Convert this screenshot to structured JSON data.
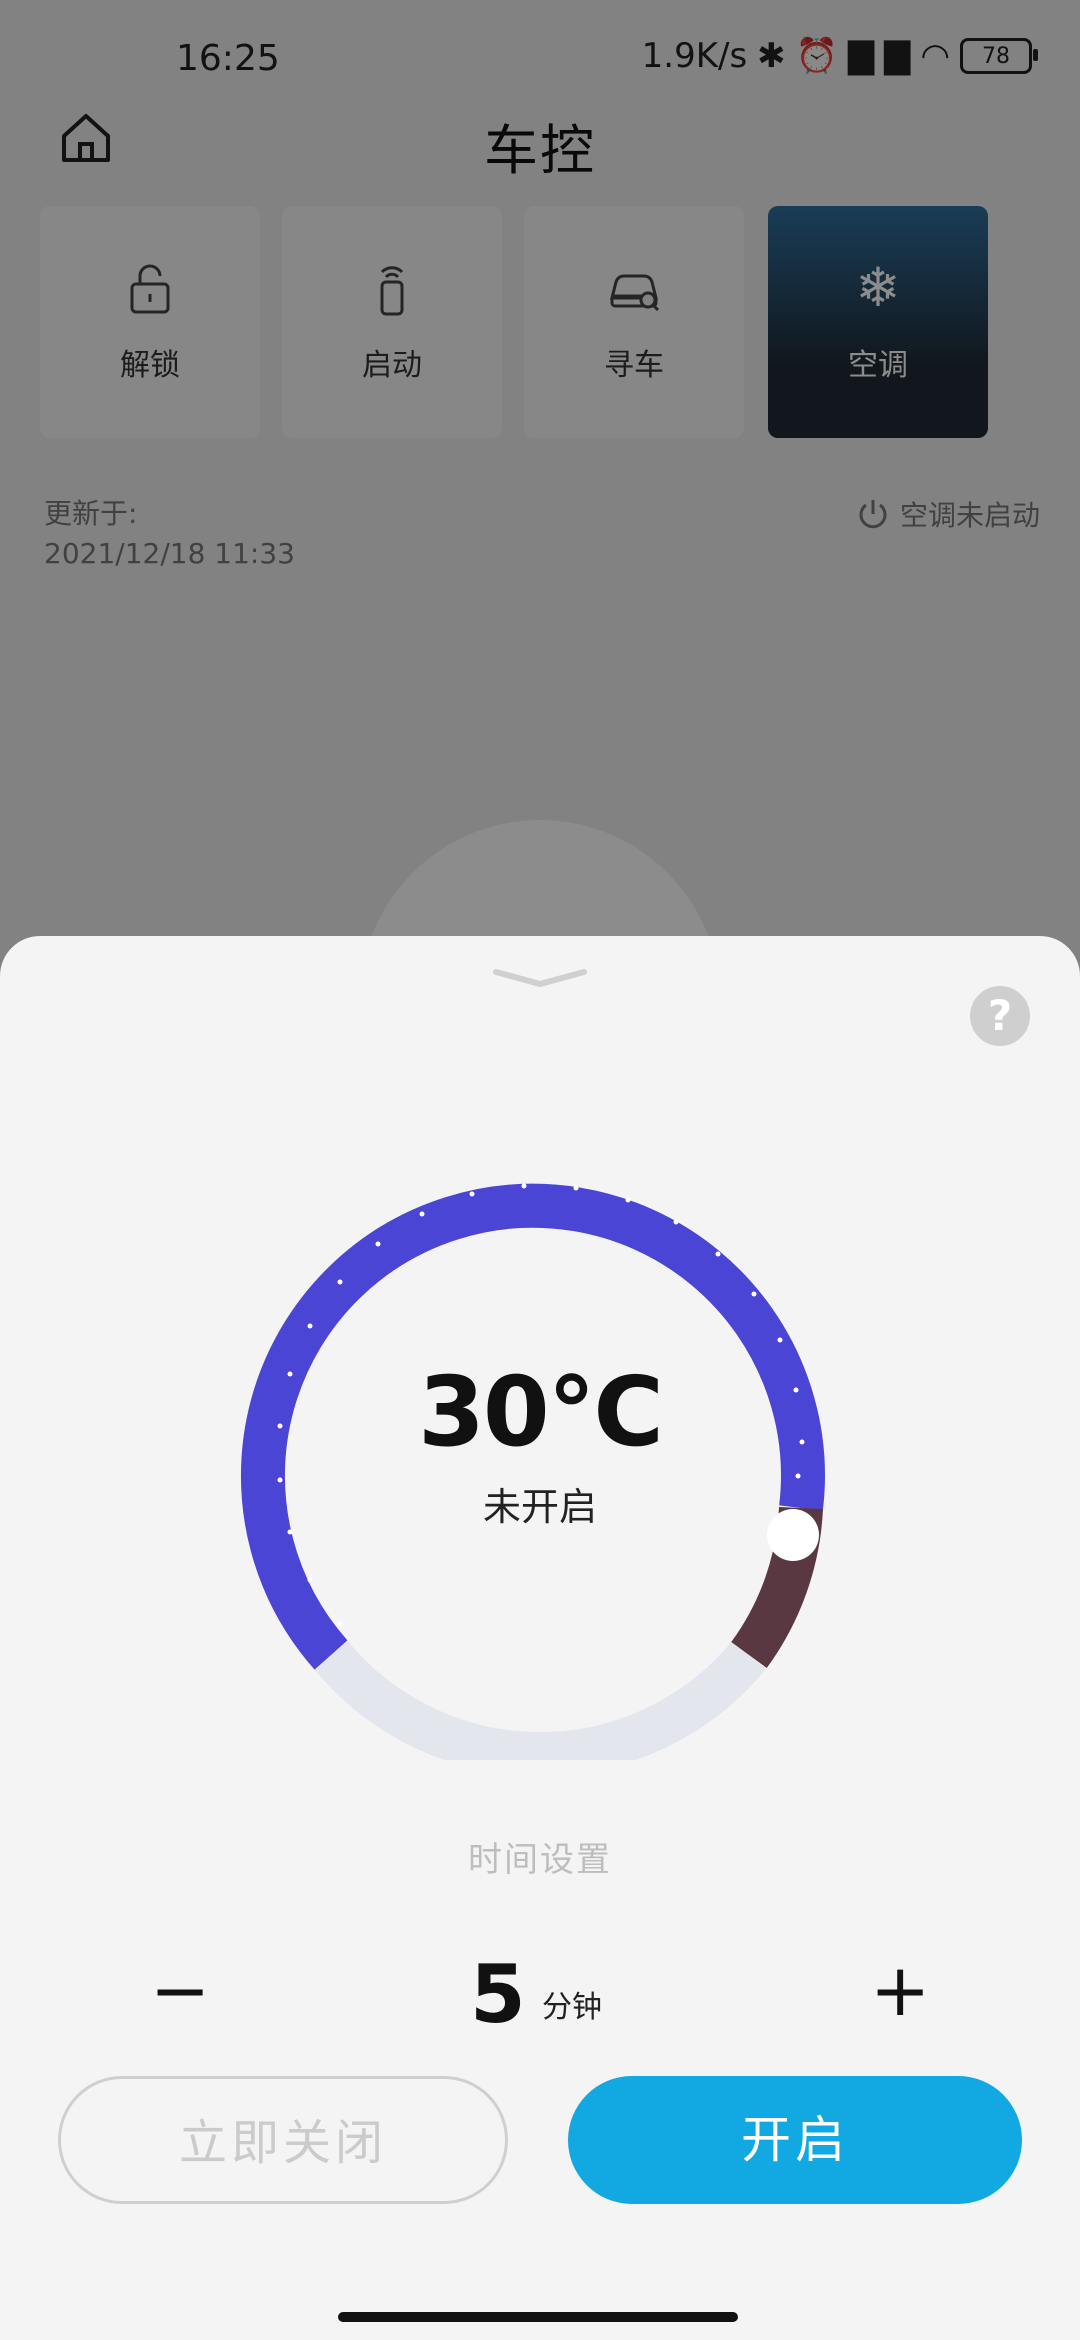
{
  "status_bar": {
    "time": "16:25",
    "net_speed": "1.9K/s",
    "battery": "78",
    "icons": [
      "bluetooth-icon",
      "alarm-icon",
      "signal-hd-icon",
      "signal-hd-icon",
      "wifi-icon",
      "battery-icon"
    ]
  },
  "header": {
    "title": "车控"
  },
  "controls": [
    {
      "label": "解锁",
      "icon": "unlock-icon"
    },
    {
      "label": "启动",
      "icon": "remote-start-icon"
    },
    {
      "label": "寻车",
      "icon": "find-car-icon"
    },
    {
      "label": "空调",
      "icon": "snowflake-icon",
      "active": true
    }
  ],
  "update": {
    "label": "更新于:",
    "time": "2021/12/18 11:33"
  },
  "ac_status": {
    "text": "空调未启动",
    "icon": "power-icon"
  },
  "sheet": {
    "help": "?",
    "temperature": "30℃",
    "temp_status": "未开启",
    "time_label": "时间设置",
    "minus": "−",
    "plus": "+",
    "minutes": "5",
    "minutes_unit": "分钟",
    "close_button": "立即关闭",
    "open_button": "开启"
  },
  "colors": {
    "accent": "#12a9e3",
    "dial_blue": "#4b45d6",
    "dial_dark": "#5a3841",
    "dial_track": "#e3e6ed"
  }
}
